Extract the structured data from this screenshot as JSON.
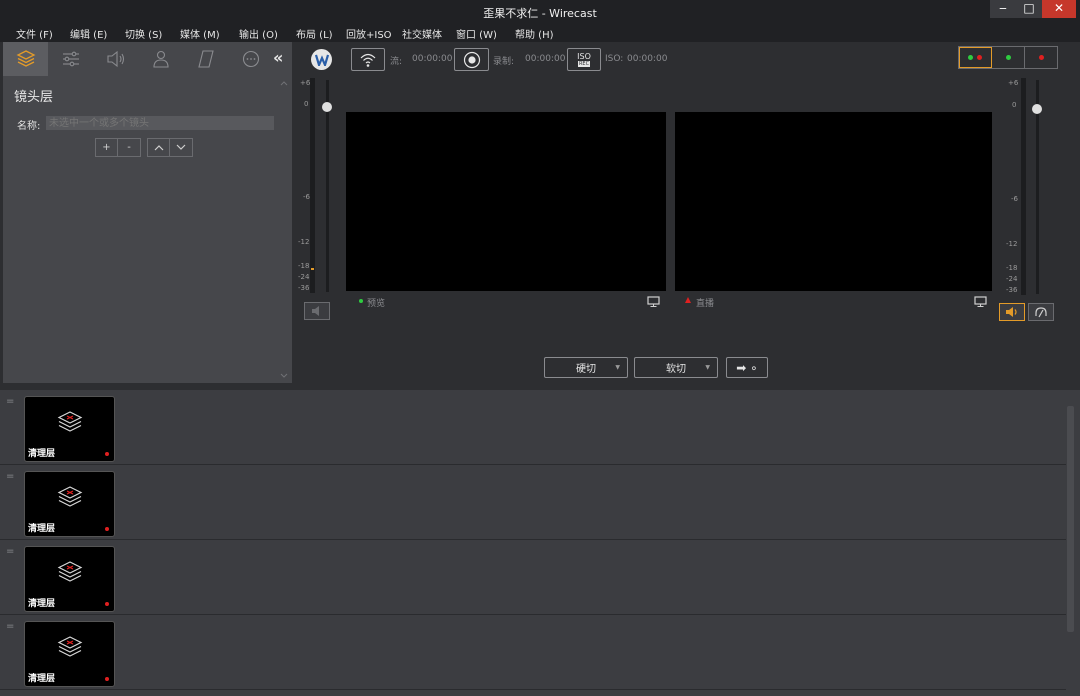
{
  "window": {
    "title": "歪果不求仁 - Wirecast",
    "min": "‒",
    "max": "□",
    "close": "✕"
  },
  "menu": [
    "文件 (F)",
    "编辑 (E)",
    "切换 (S)",
    "媒体 (M)",
    "输出 (O)",
    "布局 (L)",
    "回放+ISO",
    "社交媒体",
    "窗口 (W)",
    "帮助 (H)"
  ],
  "left_panel": {
    "tabs": [
      "layers-icon",
      "sliders-icon",
      "speaker-icon",
      "person-icon",
      "parallelogram-icon",
      "more-icon"
    ],
    "collapse": "«",
    "title": "镜头层",
    "name_label": "名称:",
    "name_placeholder": "未选中一个或多个镜头",
    "buttons": [
      "+",
      "-",
      "^",
      "v"
    ]
  },
  "audio": {
    "left_scale": [
      "+6",
      "0",
      "-6",
      "-12",
      "-18",
      "-24",
      "-36"
    ],
    "right_scale": [
      "+6",
      "0",
      "-6",
      "-12",
      "-18",
      "-24",
      "-36"
    ]
  },
  "toolbar": {
    "stream_label": "流:",
    "stream_time": "00:00:00",
    "record_label": "录制:",
    "record_time": "00:00:00",
    "iso_icon_top": "ISO",
    "iso_icon_bottom": "REC",
    "iso_label": "ISO:",
    "iso_time": "00:00:00"
  },
  "lights": [
    [
      "#2ecc40",
      "#e02020"
    ],
    [
      "#2ecc40"
    ],
    [
      "#e02020"
    ]
  ],
  "monitors": {
    "preview_label": "预览",
    "live_label": "直播",
    "preview_color": "#2ecc40",
    "live_color": "#e02020"
  },
  "transition": {
    "hard_cut": "硬切",
    "soft_cut": "软切",
    "go": "➡ ∘"
  },
  "layers": [
    {
      "label": "清理层"
    },
    {
      "label": "清理层"
    },
    {
      "label": "清理层"
    },
    {
      "label": "清理层"
    }
  ],
  "colors": {
    "accent": "#e39b29",
    "bg": "#2d2e31",
    "panel": "#46474b"
  }
}
